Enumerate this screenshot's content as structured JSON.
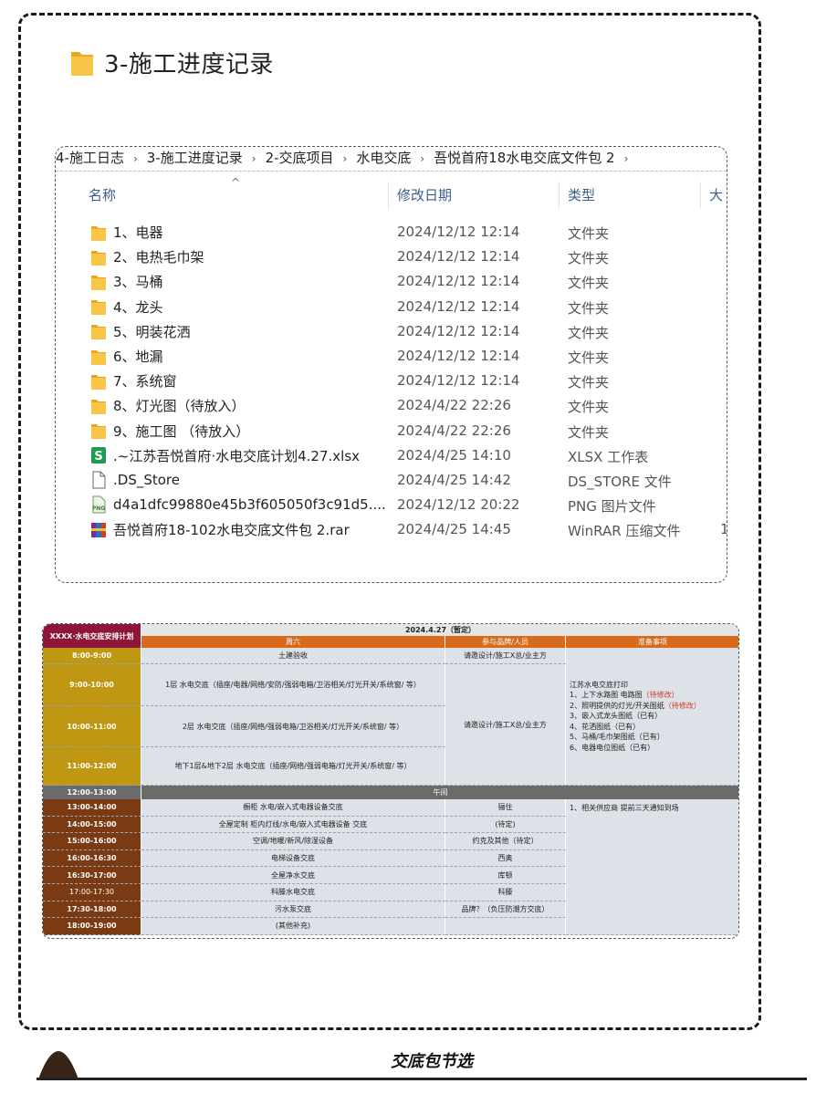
{
  "heading": {
    "title": "3-施工进度记录"
  },
  "explorer": {
    "breadcrumb": [
      "4-施工日志",
      "3-施工进度记录",
      "2-交底项目",
      "水电交底",
      "吾悦首府18水电交底文件包 2"
    ],
    "columns": {
      "name": "名称",
      "date": "修改日期",
      "type": "类型",
      "size": "大"
    },
    "files": [
      {
        "name": "1、电器",
        "date": "2024/12/12 12:14",
        "type": "文件夹",
        "icon": "folder-icon"
      },
      {
        "name": "2、电热毛巾架",
        "date": "2024/12/12 12:14",
        "type": "文件夹",
        "icon": "folder-icon"
      },
      {
        "name": "3、马桶",
        "date": "2024/12/12 12:14",
        "type": "文件夹",
        "icon": "folder-icon"
      },
      {
        "name": "4、龙头",
        "date": "2024/12/12 12:14",
        "type": "文件夹",
        "icon": "folder-icon"
      },
      {
        "name": "5、明装花洒",
        "date": "2024/12/12 12:14",
        "type": "文件夹",
        "icon": "folder-icon"
      },
      {
        "name": "6、地漏",
        "date": "2024/12/12 12:14",
        "type": "文件夹",
        "icon": "folder-icon"
      },
      {
        "name": "7、系统窗",
        "date": "2024/12/12 12:14",
        "type": "文件夹",
        "icon": "folder-icon"
      },
      {
        "name": "8、灯光图（待放入）",
        "date": "2024/4/22 22:26",
        "type": "文件夹",
        "icon": "folder-icon"
      },
      {
        "name": "9、施工图 （待放入）",
        "date": "2024/4/22 22:26",
        "type": "文件夹",
        "icon": "folder-icon"
      },
      {
        "name": ".~江苏吾悦首府·水电交底计划4.27.xlsx",
        "date": "2024/4/25 14:10",
        "type": "XLSX 工作表",
        "icon": "spreadsheet-icon"
      },
      {
        "name": ".DS_Store",
        "date": "2024/4/25 14:42",
        "type": "DS_STORE 文件",
        "icon": "file-icon"
      },
      {
        "name": "d4a1dfc99880e45b3f605050f3c91d5....",
        "date": "2024/12/12 20:22",
        "type": "PNG 图片文件",
        "icon": "png-icon"
      },
      {
        "name": "吾悦首府18-102水电交底文件包 2.rar",
        "date": "2024/4/25 14:45",
        "type": "WinRAR 压缩文件",
        "icon": "rar-icon",
        "extra": "1"
      }
    ]
  },
  "schedule": {
    "header": {
      "label": "XXXX·水电交底安排计划",
      "date": "2024.4.27（暂定）",
      "day": "周六",
      "people_header": "参与品牌/人员",
      "prep_header": "准备事项"
    },
    "morning": [
      {
        "time": "8:00-9:00",
        "task": "土建验收",
        "people": "请邀设计/施工X总/业主方"
      },
      {
        "time": "9:00-10:00",
        "task": "1层 水电交底（插座/电器/网络/安防/强弱电箱/卫浴相关/灯光开关/系统窗/ 等）"
      },
      {
        "time": "10:00-11:00",
        "task": "2层 水电交底（插座/网络/强弱电箱/卫浴相关/灯光开关/系统窗/ 等）"
      },
      {
        "time": "11:00-12:00",
        "task": "地下1层&地下2层 水电交底（插座/网络/强弱电箱/灯光开关/系统窗/ 等）"
      }
    ],
    "morning_people": "请邀设计/施工X总/业主方",
    "prep_notes": [
      {
        "text": "江苏水电交底打印",
        "mark": ""
      },
      {
        "text": "1、上下水路图 电路图",
        "mark": "（待修改）"
      },
      {
        "text": "2、照明提供的灯光/开关图纸",
        "mark": "（待修改）"
      },
      {
        "text": "3、嵌入式龙头图纸（已有）",
        "mark": ""
      },
      {
        "text": "4、花洒图纸（已有）",
        "mark": ""
      },
      {
        "text": "5、马桶/毛巾架图纸（已有）",
        "mark": ""
      },
      {
        "text": "6、电器电位图纸（已有）",
        "mark": ""
      }
    ],
    "lunch": {
      "time": "12:00-13:00",
      "label": "午间"
    },
    "afternoon": [
      {
        "time": "13:00-14:00",
        "task": "橱柜 水电/嵌入式电器设备交底",
        "people": "骊住"
      },
      {
        "time": "14:00-15:00",
        "task": "全屋定制 柜内灯线/水电/嵌入式电器设备 交底",
        "people": "(待定)"
      },
      {
        "time": "15:00-16:00",
        "task": "空调/地暖/新风/除湿设备",
        "people": "约克及其他（待定）"
      },
      {
        "time": "16:00-16:30",
        "task": "电梯设备交底",
        "people": "西奥"
      },
      {
        "time": "16:30-17:00",
        "task": "全屋净水交底",
        "people": "库顿"
      },
      {
        "time": "17:00-17:30",
        "task": "科滕水电交底",
        "people": "科滕"
      },
      {
        "time": "17:30-18:00",
        "task": "污水泵交底",
        "people": "品牌？（负压防潮方交底）"
      },
      {
        "time": "18:00-19:00",
        "task": "(其他补充)",
        "people": ""
      }
    ],
    "afternoon_note": "1、相关供应商 提前三天通知到场"
  },
  "footer": {
    "caption": "交底包节选"
  },
  "colors": {
    "header_crimson": "#8f1639",
    "orange": "#d86a1c",
    "gold": "#c09712",
    "gray": "#6b6b6b",
    "brown": "#7c3a12",
    "cell_bg": "#dde1e8"
  }
}
